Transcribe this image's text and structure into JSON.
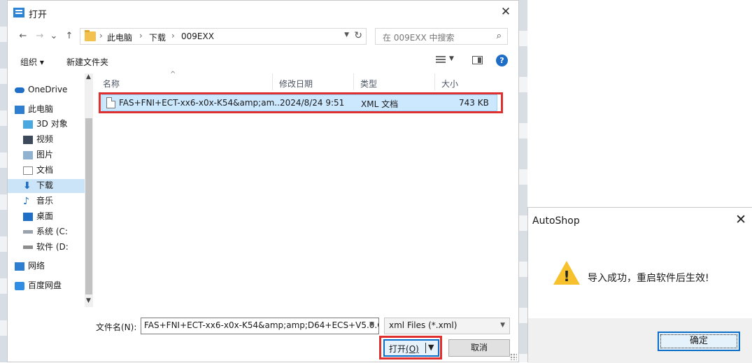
{
  "open_dialog": {
    "title": "打开",
    "close_glyph": "✕",
    "nav": {
      "back": "←",
      "forward": "→",
      "recent": "⌄",
      "up": "↑"
    },
    "breadcrumb": [
      "此电脑",
      "下载",
      "009EXX"
    ],
    "breadcrumb_sep": "›",
    "search_placeholder": "在 009EXX 中搜索",
    "toolbar": {
      "organize": "组织 ▾",
      "new_folder": "新建文件夹"
    },
    "nav_pane": [
      {
        "label": "OneDrive"
      },
      {
        "label": "此电脑"
      },
      {
        "label": "3D 对象"
      },
      {
        "label": "视频"
      },
      {
        "label": "图片"
      },
      {
        "label": "文档"
      },
      {
        "label": "下载"
      },
      {
        "label": "音乐"
      },
      {
        "label": "桌面"
      },
      {
        "label": "系统 (C:"
      },
      {
        "label": "软件 (D:"
      },
      {
        "label": "网络"
      },
      {
        "label": "百度网盘"
      }
    ],
    "columns": {
      "name": "名称",
      "modified": "修改日期",
      "type": "类型",
      "size": "大小"
    },
    "files": [
      {
        "name": "FAS+FNI+ECT-xx6-x0x-K54&amp;am...",
        "modified": "2024/8/24 9:51",
        "type": "XML 文档",
        "size": "743 KB"
      }
    ],
    "filename_label": "文件名(N):",
    "filename_value": "FAS+FNI+ECT-xx6-x0x-K54&amp;amp;D64+ECS+V5.0.C",
    "filter_value": "xml Files (*.xml)",
    "open_label": "打开",
    "open_accel": "(O)",
    "cancel_label": "取消"
  },
  "message_box": {
    "title": "AutoShop",
    "close_glyph": "✕",
    "message": "导入成功，重启软件后生效!",
    "ok_label": "确定"
  },
  "colors": {
    "highlight_red": "#e02f2f",
    "selection_blue": "#cce8ff",
    "accent": "#0b6ec9",
    "warning_yellow": "#f6c12c"
  }
}
